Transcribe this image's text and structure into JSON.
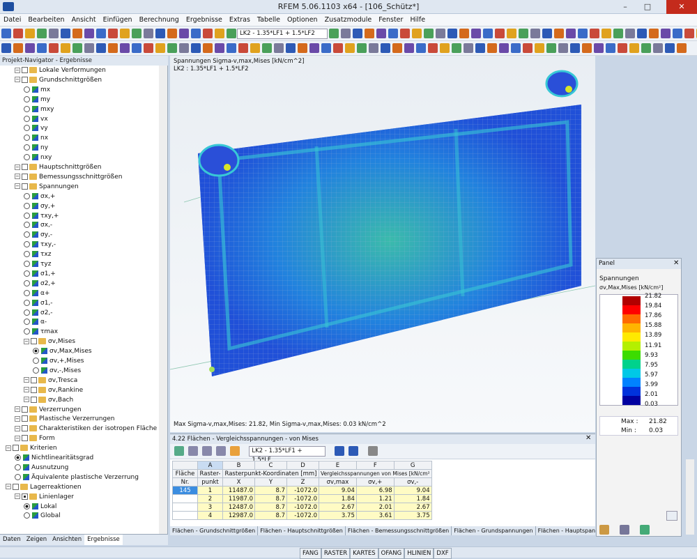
{
  "app": {
    "title": "RFEM 5.06.1103 x64 - [106_Schütz*]"
  },
  "menu": [
    "Datei",
    "Bearbeiten",
    "Ansicht",
    "Einfügen",
    "Berechnung",
    "Ergebnisse",
    "Extras",
    "Tabelle",
    "Optionen",
    "Zusatzmodule",
    "Fenster",
    "Hilfe"
  ],
  "toolbar": {
    "loadcase_combo": "LK2 - 1.35*LF1 + 1.5*LF2"
  },
  "navigator": {
    "title": "Projekt-Navigator - Ergebnisse",
    "items": [
      {
        "label": "Lokale Verformungen",
        "type": "group",
        "lvl": 2
      },
      {
        "label": "Grundschnittgrößen",
        "type": "group",
        "lvl": 2
      },
      {
        "label": "mx",
        "type": "radio",
        "lvl": 3
      },
      {
        "label": "my",
        "type": "radio",
        "lvl": 3
      },
      {
        "label": "mxy",
        "type": "radio",
        "lvl": 3
      },
      {
        "label": "vx",
        "type": "radio",
        "lvl": 3
      },
      {
        "label": "vy",
        "type": "radio",
        "lvl": 3
      },
      {
        "label": "nx",
        "type": "radio",
        "lvl": 3
      },
      {
        "label": "ny",
        "type": "radio",
        "lvl": 3
      },
      {
        "label": "nxy",
        "type": "radio",
        "lvl": 3
      },
      {
        "label": "Hauptschnittgrößen",
        "type": "group",
        "lvl": 2
      },
      {
        "label": "Bemessungsschnittgrößen",
        "type": "group",
        "lvl": 2
      },
      {
        "label": "Spannungen",
        "type": "group",
        "lvl": 2
      },
      {
        "label": "σx,+",
        "type": "radio",
        "lvl": 3
      },
      {
        "label": "σy,+",
        "type": "radio",
        "lvl": 3
      },
      {
        "label": "τxy,+",
        "type": "radio",
        "lvl": 3
      },
      {
        "label": "σx,-",
        "type": "radio",
        "lvl": 3
      },
      {
        "label": "σy,-",
        "type": "radio",
        "lvl": 3
      },
      {
        "label": "τxy,-",
        "type": "radio",
        "lvl": 3
      },
      {
        "label": "τxz",
        "type": "radio",
        "lvl": 3
      },
      {
        "label": "τyz",
        "type": "radio",
        "lvl": 3
      },
      {
        "label": "σ1,+",
        "type": "radio",
        "lvl": 3
      },
      {
        "label": "σ2,+",
        "type": "radio",
        "lvl": 3
      },
      {
        "label": "α+",
        "type": "radio",
        "lvl": 3
      },
      {
        "label": "σ1,-",
        "type": "radio",
        "lvl": 3
      },
      {
        "label": "σ2,-",
        "type": "radio",
        "lvl": 3
      },
      {
        "label": "α-",
        "type": "radio",
        "lvl": 3
      },
      {
        "label": "τmax",
        "type": "radio",
        "lvl": 3
      },
      {
        "label": "σv,Mises",
        "type": "group",
        "lvl": 3
      },
      {
        "label": "σv,Max,Mises",
        "type": "radio",
        "lvl": 4,
        "on": true
      },
      {
        "label": "σv,+,Mises",
        "type": "radio",
        "lvl": 4
      },
      {
        "label": "σv,-,Mises",
        "type": "radio",
        "lvl": 4
      },
      {
        "label": "σv,Tresca",
        "type": "group",
        "lvl": 3
      },
      {
        "label": "σv,Rankine",
        "type": "group",
        "lvl": 3
      },
      {
        "label": "σv,Bach",
        "type": "group",
        "lvl": 3
      },
      {
        "label": "Verzerrungen",
        "type": "group",
        "lvl": 2
      },
      {
        "label": "Plastische Verzerrungen",
        "type": "group",
        "lvl": 2
      },
      {
        "label": "Charakteristiken der isotropen Fläche",
        "type": "group",
        "lvl": 2
      },
      {
        "label": "Form",
        "type": "group",
        "lvl": 2
      },
      {
        "label": "Kriterien",
        "type": "group",
        "lvl": 1
      },
      {
        "label": "Nichtlinearitätsgrad",
        "type": "radio",
        "lvl": 2,
        "on": true
      },
      {
        "label": "Ausnutzung",
        "type": "radio",
        "lvl": 2
      },
      {
        "label": "Äquivalente plastische Verzerrung",
        "type": "radio",
        "lvl": 2
      },
      {
        "label": "Lagerreaktionen",
        "type": "group",
        "lvl": 1
      },
      {
        "label": "Linienlager",
        "type": "group",
        "lvl": 2,
        "on": true
      },
      {
        "label": "Lokal",
        "type": "radio",
        "lvl": 3,
        "on": true
      },
      {
        "label": "Global",
        "type": "radio",
        "lvl": 3
      }
    ],
    "tabs": [
      "Daten",
      "Zeigen",
      "Ansichten",
      "Ergebnisse"
    ]
  },
  "view": {
    "info_line1": "Spannungen Sigma-v,max,Mises [kN/cm^2]",
    "info_line2": "LK2 : 1.35*LF1 + 1.5*LF2",
    "footer": "Max Sigma-v,max,Mises: 21.82, Min Sigma-v,max,Mises: 0.03 kN/cm^2"
  },
  "panel": {
    "title": "Panel",
    "heading": "Spannungen",
    "unit_label": "σv,Max,Mises [kN/cm²]",
    "scale": [
      "21.82",
      "19.84",
      "17.86",
      "15.88",
      "13.89",
      "11.91",
      "9.93",
      "7.95",
      "5.97",
      "3.99",
      "2.01",
      "0.03"
    ],
    "colors": [
      "#b20000",
      "#ff0000",
      "#ff6a00",
      "#ffb400",
      "#ffea00",
      "#b4f000",
      "#3cdc00",
      "#00d28c",
      "#00c8e6",
      "#0082ff",
      "#0032dc",
      "#0000a0"
    ],
    "max_label": "Max :",
    "max_value": "21.82",
    "min_label": "Min :",
    "min_value": "0.03"
  },
  "table": {
    "title": "4.22 Flächen - Vergleichsspannungen - von Mises",
    "combo": "LK2 - 1.35*LF1 + 1.5*LF",
    "cols": [
      "A",
      "B",
      "C",
      "D",
      "E",
      "F",
      "G"
    ],
    "h_flaeche": "Fläche",
    "h_nr": "Nr.",
    "h_raster": "Raster-",
    "h_punkt": "punkt",
    "h_coords": "Rasterpunkt-Koordinaten [mm]",
    "h_vgl": "Vergleichsspannungen von Mises [kN/cm²",
    "h_x": "X",
    "h_y": "Y",
    "h_z": "Z",
    "h_e": "σv,max",
    "h_f": "σv,+",
    "h_g": "σv,-",
    "rows": [
      {
        "nr": "145",
        "p": "1",
        "x": "11487.0",
        "y": "8.7",
        "z": "-1072.0",
        "e": "9.04",
        "f": "6.98",
        "g": "9.04"
      },
      {
        "nr": "",
        "p": "2",
        "x": "11987.0",
        "y": "8.7",
        "z": "-1072.0",
        "e": "1.84",
        "f": "1.21",
        "g": "1.84"
      },
      {
        "nr": "",
        "p": "3",
        "x": "12487.0",
        "y": "8.7",
        "z": "-1072.0",
        "e": "2.67",
        "f": "2.01",
        "g": "2.67"
      },
      {
        "nr": "",
        "p": "4",
        "x": "12987.0",
        "y": "8.7",
        "z": "-1072.0",
        "e": "3.75",
        "f": "3.61",
        "g": "3.75"
      }
    ],
    "sheet_tabs": [
      "Flächen - Grundschnittgrößen",
      "Flächen - Hauptschnittgrößen",
      "Flächen - Bemessungsschnittgrößen",
      "Flächen - Grundspannungen",
      "Flächen - Hauptspannungen"
    ]
  },
  "status": [
    "FANG",
    "RASTER",
    "KARTES",
    "OFANG",
    "HLINIEN",
    "DXF"
  ]
}
